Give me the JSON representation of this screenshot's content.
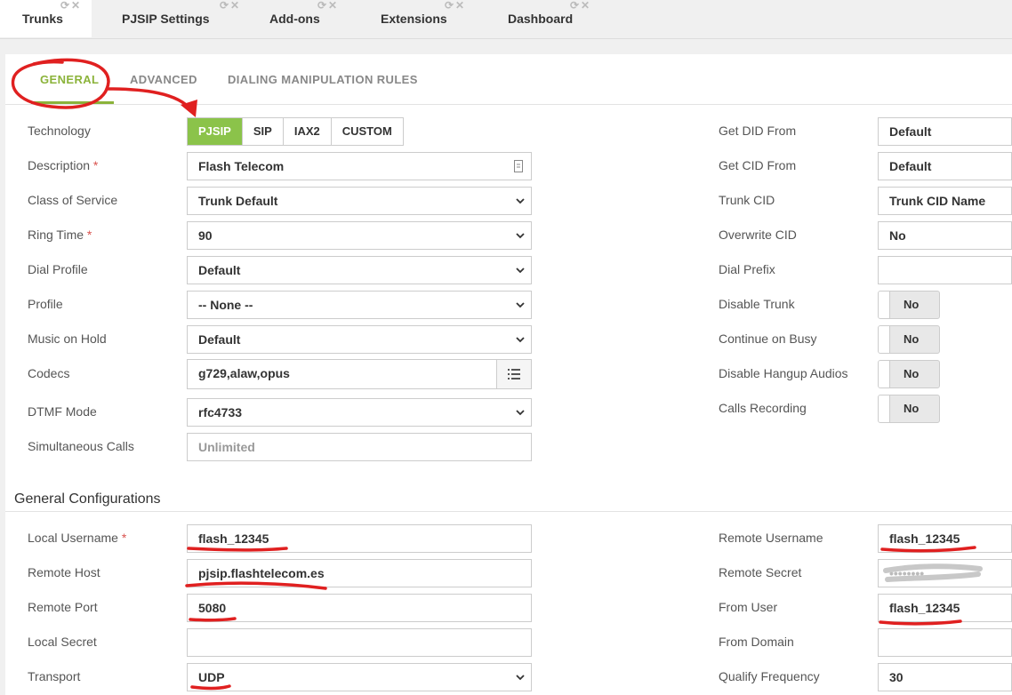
{
  "top_tabs": [
    {
      "label": "Trunks"
    },
    {
      "label": "PJSIP Settings"
    },
    {
      "label": "Add-ons"
    },
    {
      "label": "Extensions"
    },
    {
      "label": "Dashboard"
    }
  ],
  "sub_tabs": [
    "GENERAL",
    "ADVANCED",
    "DIALING MANIPULATION RULES"
  ],
  "left": {
    "technology": {
      "label": "Technology",
      "options": [
        "PJSIP",
        "SIP",
        "IAX2",
        "CUSTOM"
      ],
      "selected": "PJSIP"
    },
    "description": {
      "label": "Description",
      "required": "*",
      "value": "Flash Telecom"
    },
    "class_of_service": {
      "label": "Class of Service",
      "value": "Trunk Default"
    },
    "ring_time": {
      "label": "Ring Time",
      "required": "*",
      "value": "90"
    },
    "dial_profile": {
      "label": "Dial Profile",
      "value": "Default"
    },
    "profile": {
      "label": "Profile",
      "value": "-- None --"
    },
    "music_on_hold": {
      "label": "Music on Hold",
      "value": "Default"
    },
    "codecs": {
      "label": "Codecs",
      "value": "g729,alaw,opus"
    },
    "dtmf_mode": {
      "label": "DTMF Mode",
      "value": "rfc4733"
    },
    "simultaneous_calls": {
      "label": "Simultaneous Calls",
      "placeholder": "Unlimited"
    }
  },
  "right": {
    "get_did_from": {
      "label": "Get DID From",
      "value": "Default"
    },
    "get_cid_from": {
      "label": "Get CID From",
      "value": "Default"
    },
    "trunk_cid": {
      "label": "Trunk CID",
      "value": "Trunk CID Name"
    },
    "overwrite_cid": {
      "label": "Overwrite CID",
      "value": "No"
    },
    "dial_prefix": {
      "label": "Dial Prefix",
      "value": ""
    },
    "disable_trunk": {
      "label": "Disable Trunk",
      "value": "No"
    },
    "continue_on_busy": {
      "label": "Continue on Busy",
      "value": "No"
    },
    "disable_hangup_audios": {
      "label": "Disable Hangup Audios",
      "value": "No"
    },
    "calls_recording": {
      "label": "Calls Recording",
      "value": "No"
    }
  },
  "general_config": {
    "title": "General Configurations",
    "local_username": {
      "label": "Local Username",
      "required": "*",
      "value": "flash_12345"
    },
    "remote_host": {
      "label": "Remote Host",
      "value": "pjsip.flashtelecom.es"
    },
    "remote_port": {
      "label": "Remote Port",
      "value": "5080"
    },
    "local_secret": {
      "label": "Local Secret",
      "value": ""
    },
    "transport": {
      "label": "Transport",
      "value": "UDP"
    },
    "remote_username": {
      "label": "Remote Username",
      "value": "flash_12345"
    },
    "remote_secret": {
      "label": "Remote Secret",
      "value": "••••••••"
    },
    "from_user": {
      "label": "From User",
      "value": "flash_12345"
    },
    "from_domain": {
      "label": "From Domain",
      "value": ""
    },
    "qualify_frequency": {
      "label": "Qualify Frequency",
      "value": "30"
    }
  },
  "colors": {
    "accent": "#8bc34a",
    "annotation": "#e02020",
    "required": "#d9534f"
  }
}
